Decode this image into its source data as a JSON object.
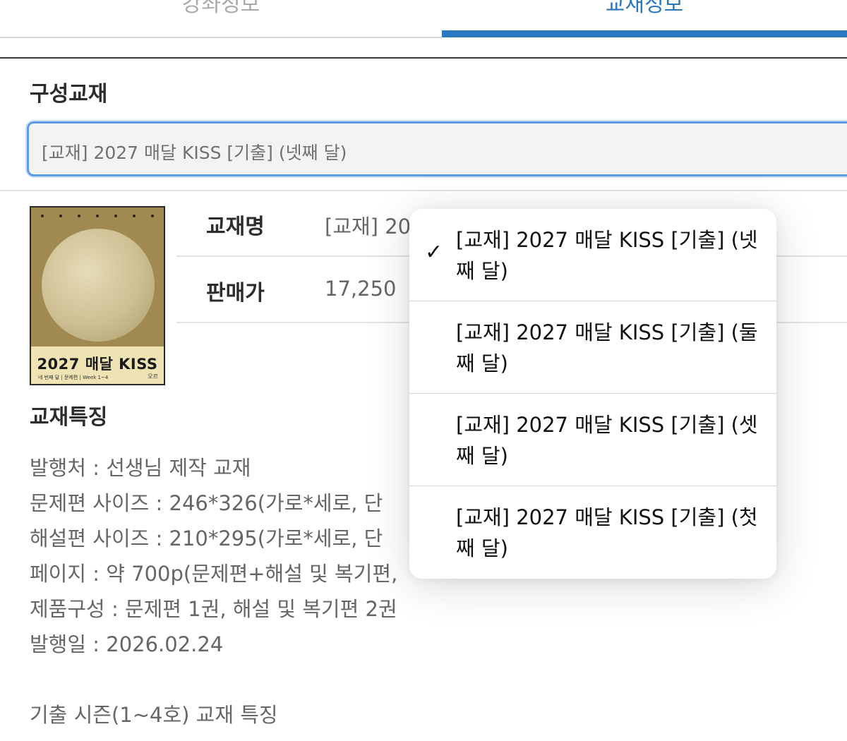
{
  "tabs": [
    {
      "label": "강좌정보",
      "active": false
    },
    {
      "label": "교재정보",
      "active": true
    }
  ],
  "colors": {
    "accent": "#2a78bf",
    "focus_border": "#5d9ce6"
  },
  "components": {
    "title": "구성교재",
    "selected_value": "[교재] 2027 매달 KISS [기출] (넷째 달)"
  },
  "book": {
    "cover_title": "2027 매달 KISS",
    "cover_subtitle": "네 번째 달 | 문제편 | Week 1~4",
    "cover_logo": "오르",
    "name_label": "교재명",
    "name_value": "[교재] 20",
    "price_label": "판매가",
    "price_value": "17,250"
  },
  "features": {
    "title": "교재특징",
    "lines": [
      "발행처 : 선생님 제작 교재",
      "문제편 사이즈 : 246*326(가로*세로, 단",
      "해설편 사이즈 : 210*295(가로*세로, 단",
      "페이지 : 약 700p(문제편+해설 및 복기편,",
      "제품구성 : 문제편 1권, 해설 및 복기편 2권",
      "발행일 : 2026.02.24",
      "",
      "기출 시즌(1~4호) 교재 특징"
    ]
  },
  "dropdown": {
    "options": [
      {
        "label": "[교재] 2027 매달 KISS [기출] (넷째 달)",
        "selected": true
      },
      {
        "label": "[교재] 2027 매달 KISS [기출] (둘째 달)",
        "selected": false
      },
      {
        "label": "[교재] 2027 매달 KISS [기출] (셋째 달)",
        "selected": false
      },
      {
        "label": "[교재] 2027 매달 KISS [기출] (첫째 달)",
        "selected": false
      }
    ],
    "check_icon": "checkmark-icon"
  }
}
